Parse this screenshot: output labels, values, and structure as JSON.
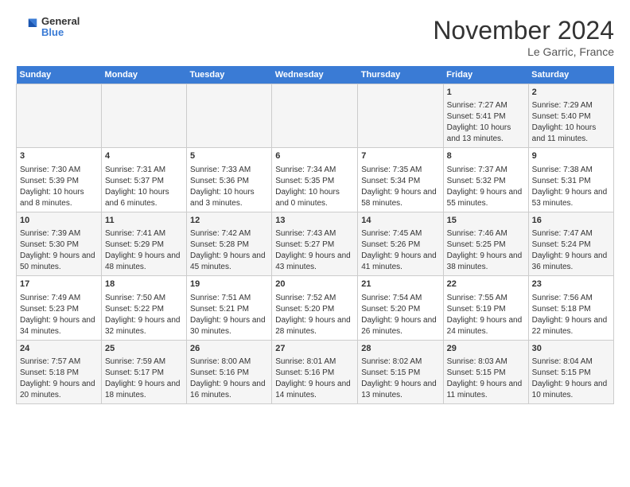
{
  "header": {
    "logo_line1": "General",
    "logo_line2": "Blue",
    "month_title": "November 2024",
    "location": "Le Garric, France"
  },
  "days_of_week": [
    "Sunday",
    "Monday",
    "Tuesday",
    "Wednesday",
    "Thursday",
    "Friday",
    "Saturday"
  ],
  "weeks": [
    [
      {
        "day": "",
        "info": ""
      },
      {
        "day": "",
        "info": ""
      },
      {
        "day": "",
        "info": ""
      },
      {
        "day": "",
        "info": ""
      },
      {
        "day": "",
        "info": ""
      },
      {
        "day": "1",
        "info": "Sunrise: 7:27 AM\nSunset: 5:41 PM\nDaylight: 10 hours and 13 minutes."
      },
      {
        "day": "2",
        "info": "Sunrise: 7:29 AM\nSunset: 5:40 PM\nDaylight: 10 hours and 11 minutes."
      }
    ],
    [
      {
        "day": "3",
        "info": "Sunrise: 7:30 AM\nSunset: 5:39 PM\nDaylight: 10 hours and 8 minutes."
      },
      {
        "day": "4",
        "info": "Sunrise: 7:31 AM\nSunset: 5:37 PM\nDaylight: 10 hours and 6 minutes."
      },
      {
        "day": "5",
        "info": "Sunrise: 7:33 AM\nSunset: 5:36 PM\nDaylight: 10 hours and 3 minutes."
      },
      {
        "day": "6",
        "info": "Sunrise: 7:34 AM\nSunset: 5:35 PM\nDaylight: 10 hours and 0 minutes."
      },
      {
        "day": "7",
        "info": "Sunrise: 7:35 AM\nSunset: 5:34 PM\nDaylight: 9 hours and 58 minutes."
      },
      {
        "day": "8",
        "info": "Sunrise: 7:37 AM\nSunset: 5:32 PM\nDaylight: 9 hours and 55 minutes."
      },
      {
        "day": "9",
        "info": "Sunrise: 7:38 AM\nSunset: 5:31 PM\nDaylight: 9 hours and 53 minutes."
      }
    ],
    [
      {
        "day": "10",
        "info": "Sunrise: 7:39 AM\nSunset: 5:30 PM\nDaylight: 9 hours and 50 minutes."
      },
      {
        "day": "11",
        "info": "Sunrise: 7:41 AM\nSunset: 5:29 PM\nDaylight: 9 hours and 48 minutes."
      },
      {
        "day": "12",
        "info": "Sunrise: 7:42 AM\nSunset: 5:28 PM\nDaylight: 9 hours and 45 minutes."
      },
      {
        "day": "13",
        "info": "Sunrise: 7:43 AM\nSunset: 5:27 PM\nDaylight: 9 hours and 43 minutes."
      },
      {
        "day": "14",
        "info": "Sunrise: 7:45 AM\nSunset: 5:26 PM\nDaylight: 9 hours and 41 minutes."
      },
      {
        "day": "15",
        "info": "Sunrise: 7:46 AM\nSunset: 5:25 PM\nDaylight: 9 hours and 38 minutes."
      },
      {
        "day": "16",
        "info": "Sunrise: 7:47 AM\nSunset: 5:24 PM\nDaylight: 9 hours and 36 minutes."
      }
    ],
    [
      {
        "day": "17",
        "info": "Sunrise: 7:49 AM\nSunset: 5:23 PM\nDaylight: 9 hours and 34 minutes."
      },
      {
        "day": "18",
        "info": "Sunrise: 7:50 AM\nSunset: 5:22 PM\nDaylight: 9 hours and 32 minutes."
      },
      {
        "day": "19",
        "info": "Sunrise: 7:51 AM\nSunset: 5:21 PM\nDaylight: 9 hours and 30 minutes."
      },
      {
        "day": "20",
        "info": "Sunrise: 7:52 AM\nSunset: 5:20 PM\nDaylight: 9 hours and 28 minutes."
      },
      {
        "day": "21",
        "info": "Sunrise: 7:54 AM\nSunset: 5:20 PM\nDaylight: 9 hours and 26 minutes."
      },
      {
        "day": "22",
        "info": "Sunrise: 7:55 AM\nSunset: 5:19 PM\nDaylight: 9 hours and 24 minutes."
      },
      {
        "day": "23",
        "info": "Sunrise: 7:56 AM\nSunset: 5:18 PM\nDaylight: 9 hours and 22 minutes."
      }
    ],
    [
      {
        "day": "24",
        "info": "Sunrise: 7:57 AM\nSunset: 5:18 PM\nDaylight: 9 hours and 20 minutes."
      },
      {
        "day": "25",
        "info": "Sunrise: 7:59 AM\nSunset: 5:17 PM\nDaylight: 9 hours and 18 minutes."
      },
      {
        "day": "26",
        "info": "Sunrise: 8:00 AM\nSunset: 5:16 PM\nDaylight: 9 hours and 16 minutes."
      },
      {
        "day": "27",
        "info": "Sunrise: 8:01 AM\nSunset: 5:16 PM\nDaylight: 9 hours and 14 minutes."
      },
      {
        "day": "28",
        "info": "Sunrise: 8:02 AM\nSunset: 5:15 PM\nDaylight: 9 hours and 13 minutes."
      },
      {
        "day": "29",
        "info": "Sunrise: 8:03 AM\nSunset: 5:15 PM\nDaylight: 9 hours and 11 minutes."
      },
      {
        "day": "30",
        "info": "Sunrise: 8:04 AM\nSunset: 5:15 PM\nDaylight: 9 hours and 10 minutes."
      }
    ]
  ]
}
